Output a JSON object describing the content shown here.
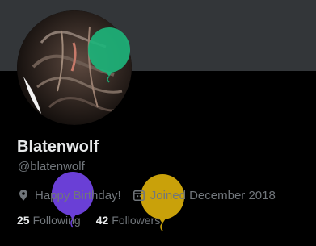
{
  "profile": {
    "display_name": "Blatenwolf",
    "handle": "@blatenwolf",
    "birthday_text": "Happy Birthday!",
    "joined_text": "Joined December 2018",
    "following_count": "25",
    "following_label": "Following",
    "followers_count": "42",
    "followers_label": "Followers"
  },
  "icons": {
    "location": "location-pin-icon",
    "calendar": "calendar-icon"
  },
  "balloon_colors": {
    "green": "#1db37a",
    "purple": "#6a3fd6",
    "yellow": "#c9a10a"
  },
  "colors": {
    "background": "#000000",
    "banner": "#333639",
    "primary_text": "#e7e9ea",
    "secondary_text": "#71767b"
  }
}
